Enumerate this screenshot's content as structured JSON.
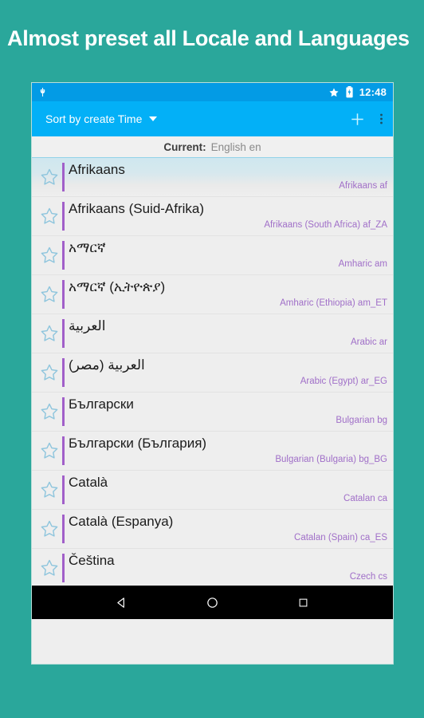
{
  "promo": {
    "headline": "Almost preset all Locale and Languages"
  },
  "status_bar": {
    "usb_icon": "usb-plug-icon",
    "star_icon": "star-filled-icon",
    "battery_icon": "battery-charging-icon",
    "time": "12:48"
  },
  "action_bar": {
    "sort_label": "Sort by create Time",
    "dropdown_icon": "chevron-down-icon",
    "add_icon": "plus-icon",
    "overflow_icon": "overflow-menu-icon"
  },
  "current": {
    "label": "Current:",
    "value": "English en"
  },
  "list": {
    "rows": [
      {
        "native": "Afrikaans",
        "english": "Afrikaans af",
        "selected": true
      },
      {
        "native": "Afrikaans (Suid-Afrika)",
        "english": "Afrikaans (South Africa) af_ZA",
        "selected": false
      },
      {
        "native": "አማርኛ",
        "english": "Amharic am",
        "selected": false
      },
      {
        "native": "አማርኛ (ኢትዮጵያ)",
        "english": "Amharic (Ethiopia) am_ET",
        "selected": false
      },
      {
        "native": "العربية",
        "english": "Arabic ar",
        "selected": false
      },
      {
        "native": "العربية (مصر)",
        "english": "Arabic (Egypt) ar_EG",
        "selected": false
      },
      {
        "native": "Български",
        "english": "Bulgarian bg",
        "selected": false
      },
      {
        "native": "Български (България)",
        "english": "Bulgarian (Bulgaria) bg_BG",
        "selected": false
      },
      {
        "native": "Català",
        "english": "Catalan ca",
        "selected": false
      },
      {
        "native": "Català (Espanya)",
        "english": "Catalan (Spain) ca_ES",
        "selected": false
      },
      {
        "native": "Čeština",
        "english": "Czech cs",
        "selected": false
      }
    ],
    "star_icon": "star-outline-icon"
  },
  "nav_bar": {
    "back_icon": "back-triangle-icon",
    "home_icon": "home-circle-icon",
    "recents_icon": "recents-square-icon"
  },
  "colors": {
    "background": "#2aa79b",
    "status_bar": "#039be5",
    "action_bar": "#03b0f7",
    "accent_purple": "#a15fc9",
    "english_text": "#a06fc8",
    "star_outline": "#8ec5dd",
    "selected_row": "#cfe7ef"
  }
}
